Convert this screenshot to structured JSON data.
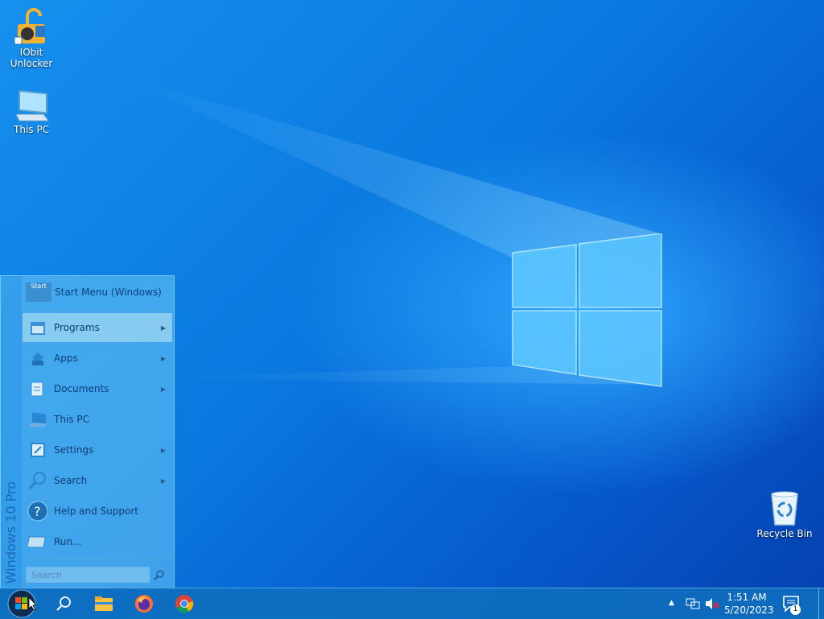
{
  "desktop": {
    "icons": [
      {
        "name": "iobit-unlocker",
        "label_line1": "IObit",
        "label_line2": "Unlocker"
      },
      {
        "name": "this-pc",
        "label_line1": "This PC"
      },
      {
        "name": "recycle-bin",
        "label_line1": "Recycle Bin"
      }
    ]
  },
  "start_menu": {
    "header_badge": "Start",
    "header": "Start Menu (Windows)",
    "side_label": "Windows 10 Pro",
    "items": [
      {
        "label": "Programs",
        "icon": "programs-icon",
        "submenu": true
      },
      {
        "label": "Apps",
        "icon": "apps-icon",
        "submenu": true
      },
      {
        "label": "Documents",
        "icon": "documents-icon",
        "submenu": true
      },
      {
        "label": "This PC",
        "icon": "computer-icon",
        "submenu": false
      },
      {
        "label": "Settings",
        "icon": "settings-icon",
        "submenu": true
      },
      {
        "label": "Search",
        "icon": "search-icon",
        "submenu": true
      },
      {
        "label": "Help and Support",
        "icon": "help-icon",
        "submenu": false
      },
      {
        "label": "Run...",
        "icon": "run-icon",
        "submenu": false
      }
    ],
    "search_placeholder": "Search",
    "arrow": "▶"
  },
  "taskbar": {
    "pinned": [
      "search-icon",
      "file-explorer-icon",
      "firefox-icon",
      "chrome-icon"
    ],
    "tray_up": "▲",
    "time": "1:51 AM",
    "date": "5/20/2023",
    "notification_count": "1"
  }
}
